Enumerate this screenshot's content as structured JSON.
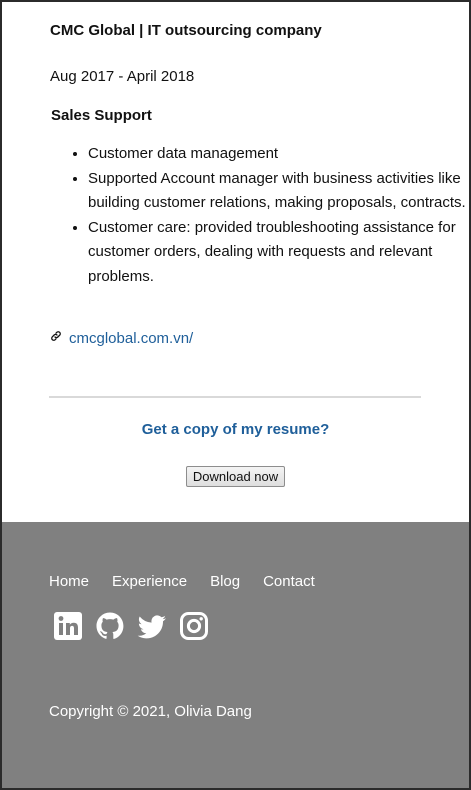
{
  "experience": {
    "company": "CMC Global | IT outsourcing company",
    "dates": "Aug 2017 - April 2018",
    "role": "Sales Support",
    "duties": [
      "Customer data management",
      "Supported Account manager with business activities like building customer relations, making proposals, contracts.",
      "Customer care: provided troubleshooting assistance for customer orders, dealing with requests and relevant problems."
    ],
    "link_icon": "link-icon",
    "link_text": "cmcglobal.com.vn/"
  },
  "cta": {
    "heading": "Get a copy of my resume?",
    "button_label": "Download now"
  },
  "footer": {
    "nav": [
      "Home",
      "Experience",
      "Blog",
      "Contact"
    ],
    "social_icons": [
      "linkedin-icon",
      "github-icon",
      "twitter-icon",
      "instagram-icon"
    ],
    "copyright": "Copyright © 2021, Olivia Dang"
  },
  "colors": {
    "accent": "#1f5f9a",
    "footer_bg": "#808080",
    "text": "#111111"
  }
}
